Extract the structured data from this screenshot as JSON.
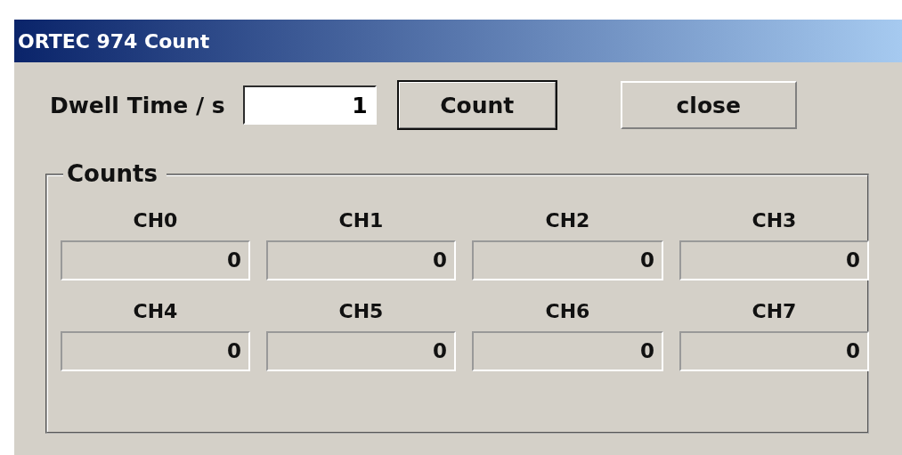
{
  "window": {
    "title": "ORTEC 974 Count"
  },
  "dwell": {
    "label": "Dwell Time / s",
    "value": "1"
  },
  "buttons": [
    {
      "label": "Count",
      "default": true
    },
    {
      "label": "close",
      "default": false
    }
  ],
  "counts": {
    "title": "Counts",
    "channels": [
      {
        "name": "CH0",
        "value": "0"
      },
      {
        "name": "CH1",
        "value": "0"
      },
      {
        "name": "CH2",
        "value": "0"
      },
      {
        "name": "CH3",
        "value": "0"
      },
      {
        "name": "CH4",
        "value": "0"
      },
      {
        "name": "CH5",
        "value": "0"
      },
      {
        "name": "CH6",
        "value": "0"
      },
      {
        "name": "CH7",
        "value": "0"
      }
    ]
  }
}
